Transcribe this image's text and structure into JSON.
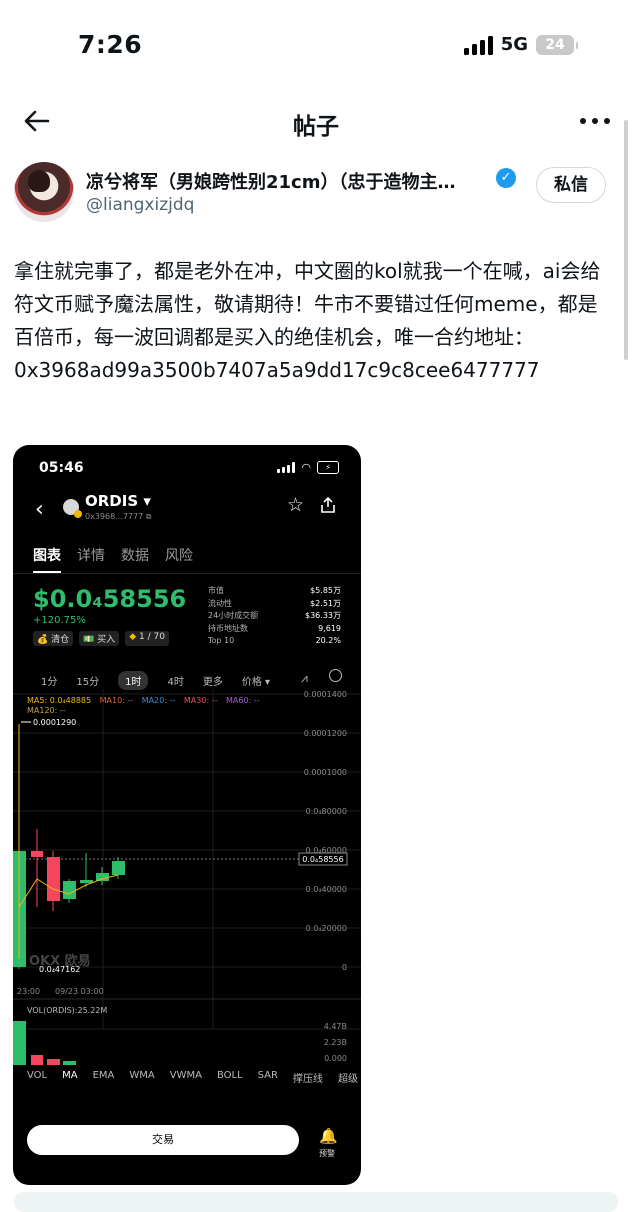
{
  "status_bar": {
    "time": "7:26",
    "network": "5G",
    "battery": "24"
  },
  "nav": {
    "title": "帖子"
  },
  "author": {
    "name": "凉兮将军（男娘跨性别21cm）（忠于造物主…",
    "handle": "@liangxizjdq",
    "dm_label": "私信"
  },
  "post": {
    "text": "拿住就完事了，都是老外在冲，中文圈的kol就我一个在喊，ai会给符文币赋予魔法属性，敬请期待！牛市不要错过任何meme，都是百倍币，每一波回调都是买入的绝佳机会，唯一合约地址：",
    "address": "0x3968ad99a3500b7407a5a9dd17c9c8cee6477777"
  },
  "embedded": {
    "time": "05:46",
    "token": "ORDIS",
    "token_addr": "0x3968...7777",
    "tabs": [
      "图表",
      "详情",
      "数据",
      "风险"
    ],
    "price": "$0.0₄58556",
    "change": "+120.75%",
    "tags": [
      "清仓",
      "买入",
      "1 / 70"
    ],
    "stats": {
      "labels": [
        "市值",
        "流动性",
        "24小时成交额",
        "持币地址数",
        "Top 10"
      ],
      "values": [
        "$5.85万",
        "$2.51万",
        "$36.33万",
        "9,619",
        "20.2%"
      ]
    },
    "intervals": [
      "1分",
      "15分",
      "1时",
      "4时",
      "更多",
      "价格"
    ],
    "ma_line": [
      "MA5: 0.0₄48885",
      "MA10: --",
      "MA20: --",
      "MA30: --",
      "MA60: --"
    ],
    "ma120": "MA120: --",
    "axis_labels": [
      "0.0001400",
      "0.0001200",
      "0.0001000",
      "0.0₄80000",
      "0.0₄60000",
      "0.0₄40000",
      "0.0₄20000",
      "0"
    ],
    "current_price_tag": "0.0₄58556",
    "high_label": "0.0001290",
    "low_label": "0.0₄47162",
    "watermark": "OKX 欧易",
    "x_labels": [
      "23:00",
      "09/23 03:00"
    ],
    "volume": {
      "label": "VOL(ORDIS):25.22M",
      "axis": [
        "4.47B",
        "2.23B",
        "0.000"
      ]
    },
    "bottom_nav": [
      "VOL",
      "MA",
      "EMA",
      "WMA",
      "VWMA",
      "BOLL",
      "SAR",
      "撑压线",
      "超级"
    ],
    "trade_label": "交易",
    "alert_label": "预警"
  },
  "colors": {
    "up": "#2ebd6b",
    "down": "#f6465d",
    "link": "#1d9bf0"
  }
}
